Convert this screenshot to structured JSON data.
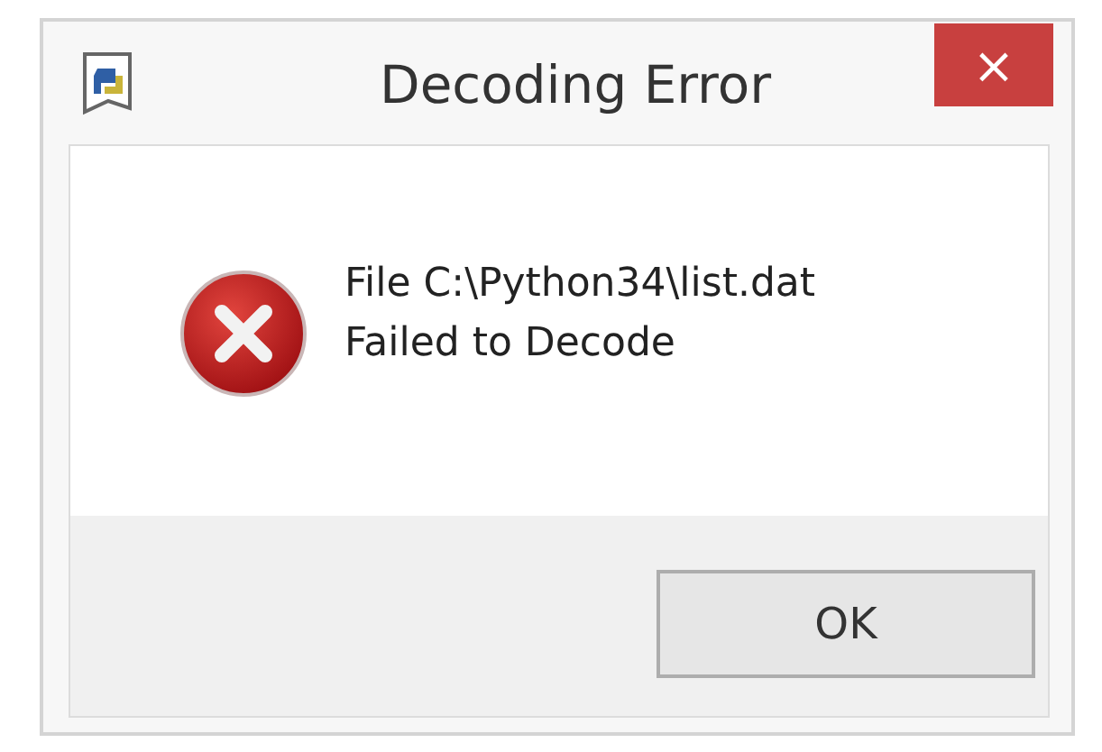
{
  "window": {
    "title": "Decoding Error",
    "close": "×"
  },
  "message_lines": [
    "File C:\\Python34\\list.dat",
    "Failed to Decode"
  ],
  "buttons": [
    {
      "label": "OK"
    }
  ]
}
